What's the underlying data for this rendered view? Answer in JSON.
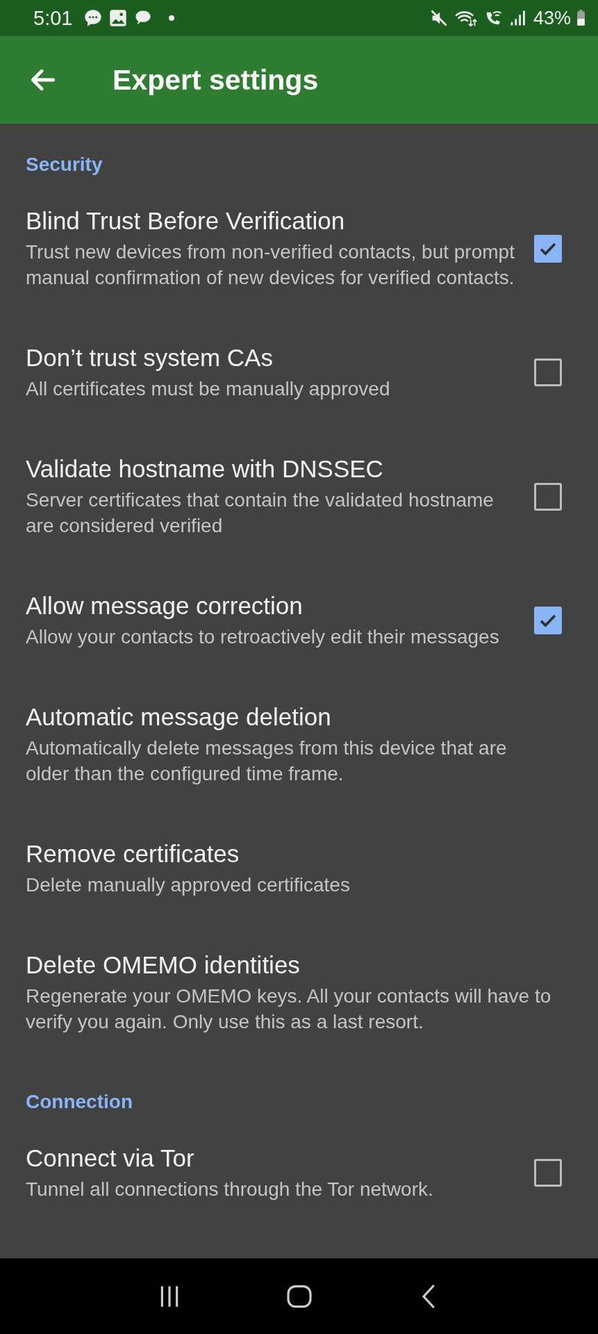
{
  "status_bar": {
    "time": "5:01",
    "battery": "43%"
  },
  "app_bar": {
    "title": "Expert settings"
  },
  "sections": [
    {
      "header": "Security",
      "items": [
        {
          "kind": "checkbox",
          "title": "Blind Trust Before Verification",
          "summary": "Trust new devices from non-verified contacts, but prompt manual confirmation of new devices for verified contacts.",
          "checked": true
        },
        {
          "kind": "checkbox",
          "title": "Don’t trust system CAs",
          "summary": "All certificates must be manually approved",
          "checked": false
        },
        {
          "kind": "checkbox",
          "title": "Validate hostname with DNSSEC",
          "summary": "Server certificates that contain the validated hostname are considered verified",
          "checked": false
        },
        {
          "kind": "checkbox",
          "title": "Allow message correction",
          "summary": "Allow your contacts to retroactively edit their messages",
          "checked": true
        },
        {
          "kind": "action",
          "title": "Automatic message deletion",
          "summary": "Automatically delete messages from this device that are older than the configured time frame."
        },
        {
          "kind": "action",
          "title": "Remove certificates",
          "summary": "Delete manually approved certificates"
        },
        {
          "kind": "action",
          "title": "Delete OMEMO identities",
          "summary": "Regenerate your OMEMO keys. All your contacts will have to verify you again. Only use this as a last resort."
        }
      ]
    },
    {
      "header": "Connection",
      "items": [
        {
          "kind": "checkbox",
          "title": "Connect via Tor",
          "summary": "Tunnel all connections through the Tor network.",
          "checked": false
        }
      ]
    }
  ]
}
